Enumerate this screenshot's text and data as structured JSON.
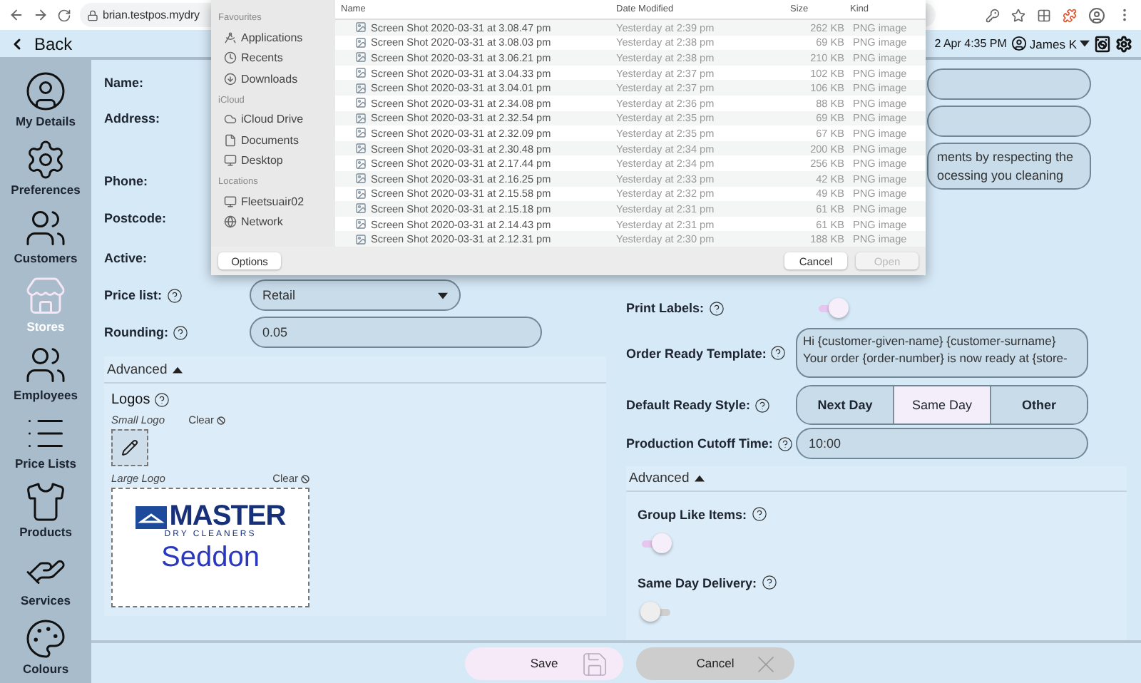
{
  "browser": {
    "url": "brian.testpos.mydry"
  },
  "header": {
    "back": "Back",
    "datetime": "2 Apr 4:35 PM",
    "user": "James K"
  },
  "sidebar": [
    {
      "label": "My Details",
      "selected": false
    },
    {
      "label": "Preferences",
      "selected": false
    },
    {
      "label": "Customers",
      "selected": false
    },
    {
      "label": "Stores",
      "selected": true
    },
    {
      "label": "Employees",
      "selected": false
    },
    {
      "label": "Price Lists",
      "selected": false
    },
    {
      "label": "Products",
      "selected": false
    },
    {
      "label": "Services",
      "selected": false
    },
    {
      "label": "Colours",
      "selected": false
    }
  ],
  "left_fields": [
    {
      "label": "Name:",
      "kind": "plain"
    },
    {
      "label": "Address:",
      "kind": "plain"
    },
    {
      "label": "Phone:",
      "kind": "plain"
    },
    {
      "label": "Postcode:",
      "kind": "plain"
    },
    {
      "label": "Active:",
      "kind": "plain"
    },
    {
      "label": "Price list:",
      "kind": "select",
      "help": true,
      "value": "Retail"
    },
    {
      "label": "Rounding:",
      "kind": "text",
      "help": true,
      "value": "0.05"
    }
  ],
  "right_top_fields": [
    {
      "kind": "blank"
    },
    {
      "kind": "blank"
    },
    {
      "kind": "text",
      "lines": [
        "ments by respecting the",
        "ocessing you cleaning"
      ]
    }
  ],
  "print_labels": {
    "label": "Print Labels:",
    "help": true,
    "on": true
  },
  "order_ready_template": {
    "label": "Order Ready Template:",
    "help": true,
    "lines": [
      "Hi {customer-given-name} {customer-surname}",
      "Your order {order-number} is now ready at {store-"
    ]
  },
  "default_ready_style": {
    "label": "Default Ready Style:",
    "help": true,
    "options": [
      {
        "label": "Next Day",
        "selected": false
      },
      {
        "label": "Same Day",
        "selected": true
      },
      {
        "label": "Other",
        "selected": false
      }
    ]
  },
  "production_cutoff": {
    "label": "Production Cutoff Time:",
    "help": true,
    "value": "10:00"
  },
  "left_advanced": {
    "header": "Advanced",
    "expanded": true,
    "logos_title": "Logos",
    "small_label": "Small Logo",
    "small_clear": "Clear",
    "large_label": "Large Logo",
    "large_clear": "Clear",
    "logo_lines": [
      "MASTER",
      "DRY CLEANERS",
      "Seddon"
    ]
  },
  "right_advanced": {
    "header": "Advanced",
    "expanded": true,
    "items": [
      {
        "label": "Group Like Items:",
        "help": true,
        "on": true
      },
      {
        "label": "Same Day Delivery:",
        "help": true,
        "on": false
      }
    ]
  },
  "footer": {
    "save": "Save",
    "cancel": "Cancel"
  },
  "file_dialog": {
    "sections": [
      {
        "title": "Favourites",
        "items": [
          "Applications",
          "Recents",
          "Downloads"
        ]
      },
      {
        "title": "iCloud",
        "items": [
          "iCloud Drive",
          "Documents",
          "Desktop"
        ]
      },
      {
        "title": "Locations",
        "items": [
          "Fleetsuair02",
          "Network"
        ]
      }
    ],
    "columns": [
      "Name",
      "Date Modified",
      "Size",
      "Kind"
    ],
    "files": [
      {
        "name": "Screen Shot 2020-03-31 at 3.08.47 pm",
        "date": "Yesterday at 2:39 pm",
        "size": "262 KB",
        "kind": "PNG image"
      },
      {
        "name": "Screen Shot 2020-03-31 at 3.08.03 pm",
        "date": "Yesterday at 2:38 pm",
        "size": "69 KB",
        "kind": "PNG image"
      },
      {
        "name": "Screen Shot 2020-03-31 at 3.06.21 pm",
        "date": "Yesterday at 2:38 pm",
        "size": "210 KB",
        "kind": "PNG image"
      },
      {
        "name": "Screen Shot 2020-03-31 at 3.04.33 pm",
        "date": "Yesterday at 2:37 pm",
        "size": "102 KB",
        "kind": "PNG image"
      },
      {
        "name": "Screen Shot 2020-03-31 at 3.04.01 pm",
        "date": "Yesterday at 2:37 pm",
        "size": "106 KB",
        "kind": "PNG image"
      },
      {
        "name": "Screen Shot 2020-03-31 at 2.34.08 pm",
        "date": "Yesterday at 2:36 pm",
        "size": "88 KB",
        "kind": "PNG image"
      },
      {
        "name": "Screen Shot 2020-03-31 at 2.32.54 pm",
        "date": "Yesterday at 2:35 pm",
        "size": "69 KB",
        "kind": "PNG image"
      },
      {
        "name": "Screen Shot 2020-03-31 at 2.32.09 pm",
        "date": "Yesterday at 2:35 pm",
        "size": "67 KB",
        "kind": "PNG image"
      },
      {
        "name": "Screen Shot 2020-03-31 at 2.30.48 pm",
        "date": "Yesterday at 2:34 pm",
        "size": "200 KB",
        "kind": "PNG image"
      },
      {
        "name": "Screen Shot 2020-03-31 at 2.17.44 pm",
        "date": "Yesterday at 2:34 pm",
        "size": "256 KB",
        "kind": "PNG image"
      },
      {
        "name": "Screen Shot 2020-03-31 at 2.16.25 pm",
        "date": "Yesterday at 2:33 pm",
        "size": "42 KB",
        "kind": "PNG image"
      },
      {
        "name": "Screen Shot 2020-03-31 at 2.15.58 pm",
        "date": "Yesterday at 2:32 pm",
        "size": "49 KB",
        "kind": "PNG image"
      },
      {
        "name": "Screen Shot 2020-03-31 at 2.15.18 pm",
        "date": "Yesterday at 2:31 pm",
        "size": "61 KB",
        "kind": "PNG image"
      },
      {
        "name": "Screen Shot 2020-03-31 at 2.14.43 pm",
        "date": "Yesterday at 2:31 pm",
        "size": "61 KB",
        "kind": "PNG image"
      },
      {
        "name": "Screen Shot 2020-03-31 at 2.12.31 pm",
        "date": "Yesterday at 2:30 pm",
        "size": "188 KB",
        "kind": "PNG image"
      }
    ],
    "options": "Options",
    "cancel": "Cancel",
    "open": {
      "label": "Open",
      "disabled": true
    }
  }
}
